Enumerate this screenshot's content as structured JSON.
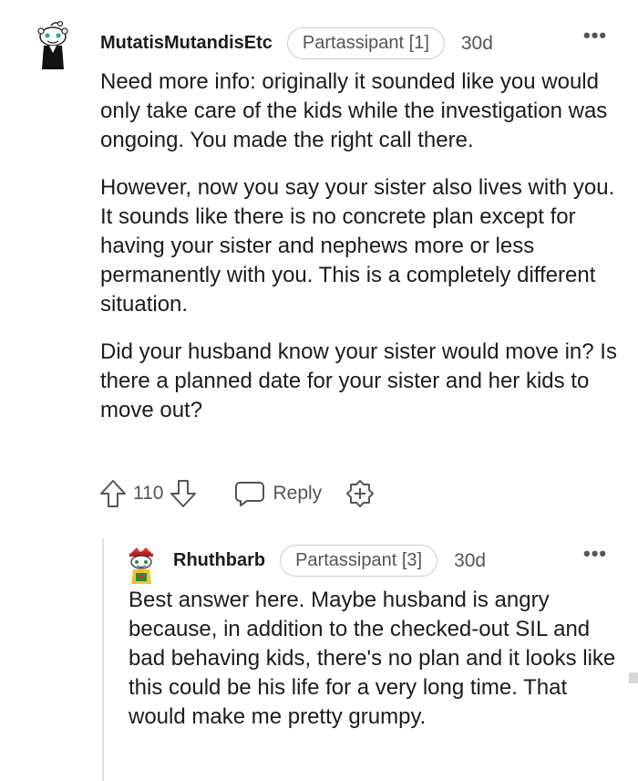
{
  "comments": [
    {
      "avatar_icon": "snoo-avatar-icon",
      "username": "MutatisMutandisEtc",
      "flair": "Partassipant [1]",
      "age": "30d",
      "more_icon": "ellipsis-icon",
      "paragraphs": [
        "Need more info: originally it sounded like you would only take care of the kids while the investigation was ongoing. You made the right call there.",
        "However, now you say your sister also lives with you. It sounds like there is no concrete plan except for having your sister and nephews more or less permanently with you. This is a completely different situation.",
        "Did your husband know your sister would move in? Is there a planned date for your sister and her kids to move out?"
      ],
      "votes": "110",
      "reply_label": "Reply"
    },
    {
      "avatar_icon": "snoo-avatar-icon",
      "username": "Rhuthbarb",
      "flair": "Partassipant [3]",
      "age": "30d",
      "more_icon": "ellipsis-icon",
      "paragraphs": [
        "Best answer here. Maybe husband is angry because, in addition to the checked-out SIL and bad behaving kids, there's no plan and it looks like this could be his life for a very long time. That would make me pretty grumpy."
      ]
    }
  ],
  "colors": {
    "text": "#1c1c1c",
    "meta": "#555555",
    "border": "#cccccc",
    "thread_line": "#e2e2e2"
  }
}
